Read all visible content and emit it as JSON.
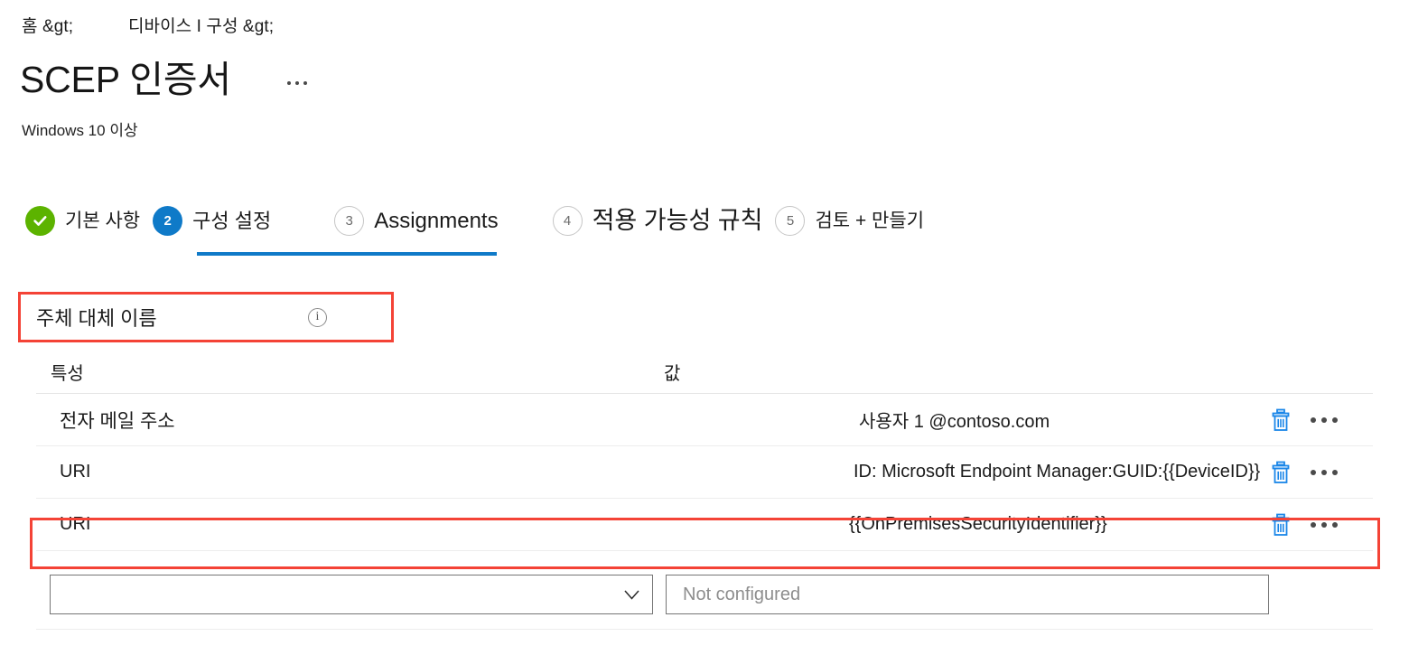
{
  "breadcrumb": {
    "items": [
      "홈 &gt;",
      "디바이스 I 구성 &gt;"
    ]
  },
  "header": {
    "title": "SCEP 인증서",
    "subtitle": "Windows 10 이상",
    "more_actions_label": "···"
  },
  "wizard": {
    "steps": [
      {
        "number": "1",
        "label": "기본 사항",
        "state": "done"
      },
      {
        "number": "2",
        "label": "구성 설정",
        "state": "active"
      },
      {
        "number": "3",
        "label": "Assignments",
        "state": "idle"
      },
      {
        "number": "4",
        "label": "적용 가능성 규칙",
        "state": "idle"
      },
      {
        "number": "5",
        "label": "검토 + 만들기",
        "state": "idle"
      }
    ]
  },
  "section": {
    "title": "주체 대체 이름",
    "info_glyph": "i"
  },
  "table": {
    "columns": {
      "attribute": "특성",
      "value": "값"
    },
    "rows": [
      {
        "attribute": "전자 메일 주소",
        "value": "사용자 1 @contoso.com"
      },
      {
        "attribute": "URI",
        "value": "ID: Microsoft Endpoint Manager:GUID:{{DeviceID}}"
      },
      {
        "attribute": "URI",
        "value": "{{OnPremisesSecurityIdentifier}}"
      }
    ],
    "row_actions": {
      "delete_label": "삭제",
      "more_label": "더 보기"
    }
  },
  "new_entry": {
    "attribute_placeholder": "",
    "attribute_value": "",
    "value_placeholder": "Not configured",
    "value_value": ""
  },
  "colors": {
    "accent_blue": "#0f7ac8",
    "success_green": "#5cb300",
    "highlight_red": "#f44336",
    "icon_blue": "#1a86e8",
    "text": "#1b1b1b",
    "border_gray": "#757575"
  }
}
